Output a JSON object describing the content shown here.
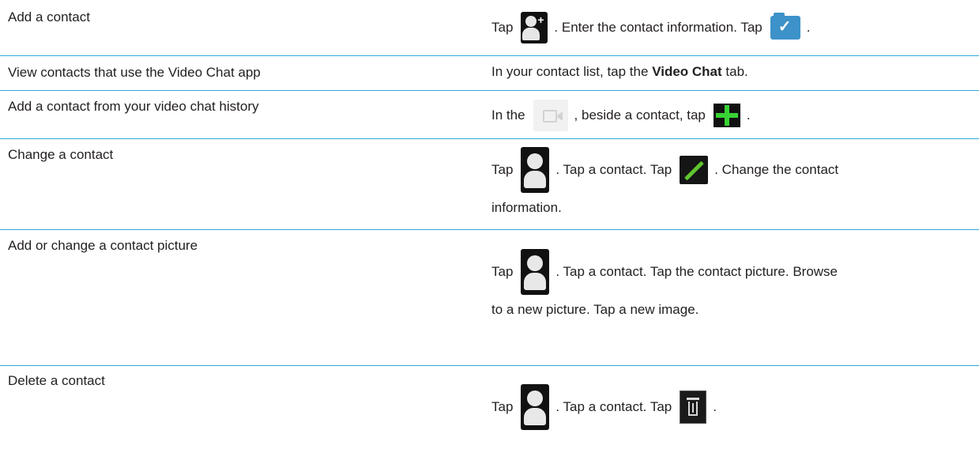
{
  "rows": [
    {
      "task": "Add a contact",
      "how": {
        "t1": "Tap",
        "t2": ". Enter the contact information. Tap",
        "t3": "."
      }
    },
    {
      "task": "View contacts that use the Video Chat app",
      "how": {
        "t1": "In your contact list, tap the",
        "bold": "Video Chat",
        "t2": "tab."
      }
    },
    {
      "task": "Add a contact from your video chat history",
      "how": {
        "t1": "In the",
        "t2": ", beside a contact, tap",
        "t3": "."
      }
    },
    {
      "task": "Change a contact",
      "how": {
        "t1": "Tap",
        "t2": ". Tap a contact. Tap",
        "t3": ". Change the contact",
        "line2": "information."
      }
    },
    {
      "task": "Add or change a contact picture",
      "how": {
        "t1": "Tap",
        "t2": ". Tap a contact. Tap the contact picture. Browse",
        "line2": "to a new picture. Tap a new image."
      }
    },
    {
      "task": "Delete a contact",
      "how": {
        "t1": "Tap",
        "t2": ". Tap a contact. Tap",
        "t3": "."
      }
    }
  ],
  "icons": {
    "add_contact": "add-contact-icon",
    "save": "save-icon",
    "video_chat": "video-chat-icon",
    "add": "plus-icon",
    "contacts": "contacts-icon",
    "edit": "edit-icon",
    "delete": "trash-icon"
  },
  "colors": {
    "separator": "#33a9d9",
    "text": "#231f20",
    "green": "#37d334",
    "blue": "#3c92c9"
  }
}
